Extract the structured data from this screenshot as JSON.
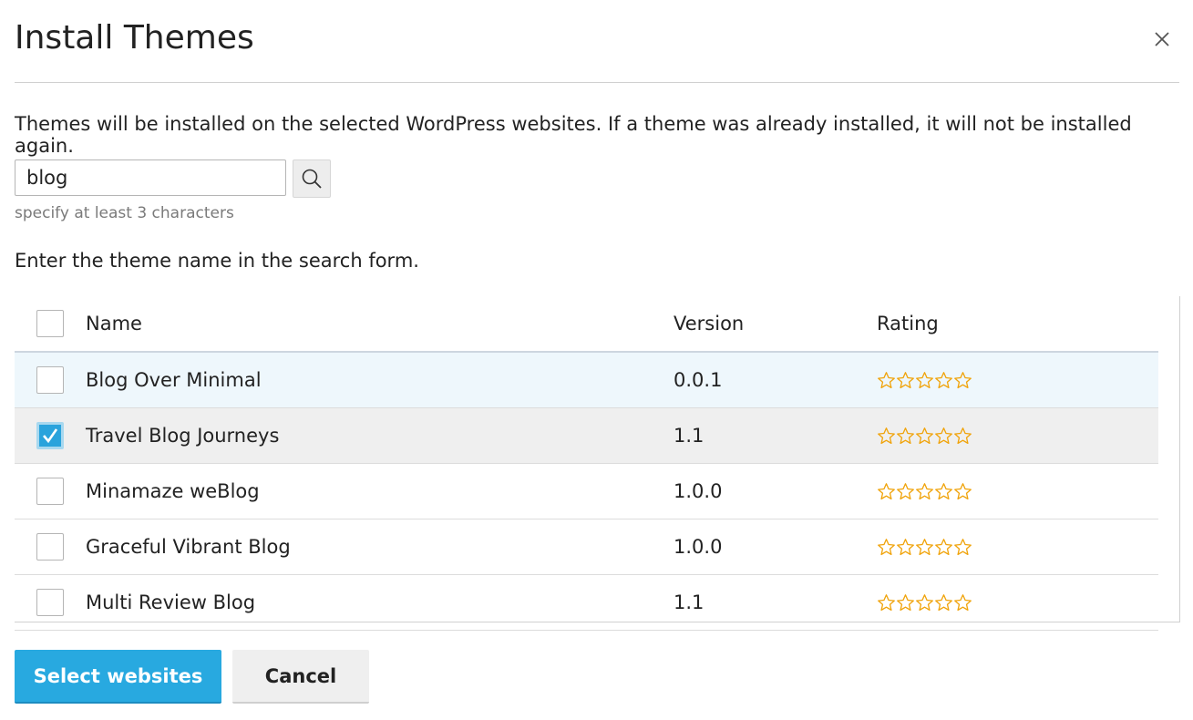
{
  "dialog": {
    "title": "Install Themes",
    "description": "Themes will be installed on the selected WordPress websites. If a theme was already installed, it will not be installed again.",
    "close_icon": "close-icon"
  },
  "search": {
    "value": "blog",
    "hint": "specify at least 3 characters",
    "icon": "search-icon"
  },
  "info_text": "Enter the theme name in the search form.",
  "table": {
    "headers": {
      "name": "Name",
      "version": "Version",
      "rating": "Rating"
    },
    "rows": [
      {
        "name": "Blog Over Minimal",
        "version": "0.0.1",
        "rating": 0,
        "checked": false,
        "state": "hover"
      },
      {
        "name": "Travel Blog Journeys",
        "version": "1.1",
        "rating": 0,
        "checked": true,
        "state": "selected"
      },
      {
        "name": "Minamaze weBlog",
        "version": "1.0.0",
        "rating": 0,
        "checked": false,
        "state": ""
      },
      {
        "name": "Graceful Vibrant Blog",
        "version": "1.0.0",
        "rating": 0,
        "checked": false,
        "state": ""
      },
      {
        "name": "Multi Review Blog",
        "version": "1.1",
        "rating": 0,
        "checked": false,
        "state": ""
      }
    ],
    "rating_max": 5
  },
  "buttons": {
    "primary": "Select websites",
    "cancel": "Cancel"
  },
  "colors": {
    "accent": "#28a9e0",
    "star": "#f0a30a"
  }
}
